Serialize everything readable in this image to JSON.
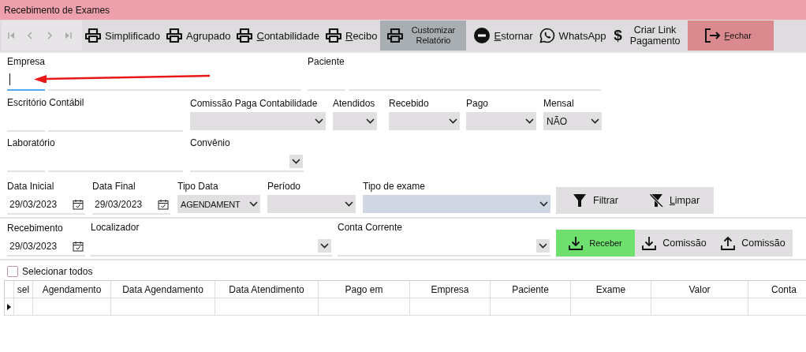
{
  "window": {
    "title": "Recebimento de Exames"
  },
  "toolbar": {
    "nav": [
      {
        "kind": "first",
        "disabled": true
      },
      {
        "kind": "prev",
        "disabled": true
      },
      {
        "kind": "next",
        "disabled": true
      },
      {
        "kind": "last",
        "disabled": true
      }
    ],
    "buttons": [
      {
        "label": "Simplificado",
        "kind": "print",
        "mnemonic": false,
        "highlighted": false,
        "danger": false
      },
      {
        "label": "Agrupado",
        "kind": "print",
        "mnemonic": false,
        "highlighted": false,
        "danger": false
      },
      {
        "label": "Contabilidade",
        "kind": "print",
        "mnemonic": true,
        "highlighted": false,
        "danger": false
      },
      {
        "label": "Recibo",
        "kind": "print",
        "mnemonic": true,
        "highlighted": false,
        "danger": false
      },
      {
        "label": "Customizar Relatório",
        "kind": "print",
        "mnemonic": false,
        "highlighted": true,
        "danger": false
      },
      {
        "label": "Estornar",
        "kind": "reverse",
        "mnemonic": true,
        "highlighted": false,
        "danger": false
      },
      {
        "label": "WhatsApp",
        "kind": "whatsapp",
        "mnemonic": false,
        "highlighted": false,
        "danger": false
      },
      {
        "label": "Criar Link Pagamento",
        "kind": "money",
        "glyph": "$",
        "mnemonic": false,
        "highlighted": false,
        "danger": false
      },
      {
        "label": "Fechar",
        "kind": "exit",
        "mnemonic": true,
        "highlighted": false,
        "danger": true
      }
    ]
  },
  "filters": [
    {
      "fields": [
        {
          "label": "Empresa",
          "kind": "lookup",
          "focused": true
        },
        {
          "label": "Paciente",
          "kind": "lookup",
          "focused": false
        }
      ]
    },
    {
      "fields": [
        {
          "label": "Escritório Contábil",
          "kind": "lookup",
          "focused": false
        },
        {
          "label": "Comissão Paga Contabilidade",
          "kind": "combo",
          "tinted": false
        },
        {
          "label": "Atendidos",
          "kind": "combo",
          "tinted": false
        },
        {
          "label": "Recebido",
          "kind": "combo",
          "tinted": false
        },
        {
          "label": "Pago",
          "kind": "combo",
          "tinted": false
        },
        {
          "label": "Mensal",
          "kind": "combo",
          "value": "NÃO",
          "tinted": false
        }
      ]
    },
    {
      "fields": [
        {
          "label": "Laboratório",
          "kind": "lookup",
          "focused": false
        },
        {
          "label": "Convênio",
          "kind": "dropdown"
        }
      ]
    },
    {
      "fields": [
        {
          "label": "Data Inicial",
          "kind": "date",
          "value": "29/03/2023"
        },
        {
          "label": "Data Final",
          "kind": "date",
          "value": "29/03/2023"
        },
        {
          "label": "Tipo Data",
          "kind": "combo",
          "value": "AGENDAMENT",
          "tinted": false
        },
        {
          "label": "Período",
          "kind": "combo",
          "tinted": false
        },
        {
          "label": "Tipo de exame",
          "kind": "combo",
          "tinted": true
        }
      ],
      "actions": [
        {
          "label": "Filtrar",
          "kind": "filter",
          "primary": false
        },
        {
          "label": "Limpar",
          "kind": "clear",
          "mnemonic": true,
          "primary": false
        }
      ]
    },
    {
      "fields": [
        {
          "label": "Recebimento",
          "kind": "date",
          "value": "29/03/2023"
        },
        {
          "label": "Localizador",
          "kind": "dropdown"
        },
        {
          "label": "Conta Corrente",
          "kind": "dropdown"
        }
      ],
      "actions": [
        {
          "label": "Receber",
          "kind": "download",
          "primary": true
        },
        {
          "label": "Comissão",
          "kind": "download",
          "primary": false
        },
        {
          "label": "Comissão",
          "kind": "upload",
          "primary": false
        }
      ]
    }
  ],
  "select_all": {
    "label": "Selecionar todos",
    "checked": false
  },
  "table": {
    "columns": [
      "sel",
      "Agendamento",
      "Data Agendamento",
      "Data Atendimento",
      "Pago em",
      "Empresa",
      "Paciente",
      "Exame",
      "Valor",
      "Conta"
    ],
    "rows": [
      {
        "current": true
      }
    ]
  }
}
